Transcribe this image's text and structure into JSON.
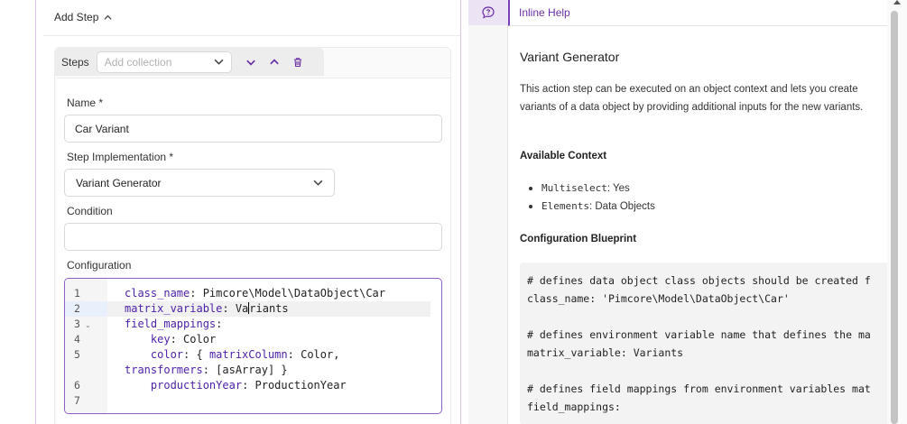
{
  "workflow": {
    "add_step_label": "Add Step",
    "steps_label": "Steps",
    "collection_placeholder": "Add collection"
  },
  "form": {
    "name_label": "Name",
    "name_value": "Car Variant",
    "step_impl_label": "Step Implementation",
    "step_impl_value": "Variant Generator",
    "condition_label": "Condition",
    "condition_value": "",
    "configuration_label": "Configuration",
    "required_mark": "*"
  },
  "editor": {
    "line_numbers": [
      "1",
      "2",
      "3",
      "4",
      "5",
      "6",
      "7"
    ],
    "lines": [
      {
        "key": "class_name",
        "rest": ": Pimcore\\Model\\DataObject\\Car"
      },
      {
        "key": "matrix_variable",
        "rest": ": Va",
        "rest2": "riants"
      },
      {
        "key": "field_mappings",
        "rest": ":"
      },
      {
        "indent": "    ",
        "key": "key",
        "rest": ": Color"
      },
      {
        "indent": "    ",
        "key": "color",
        "rest": ": { ",
        "key2": "matrixColumn",
        "rest2": ": Color,"
      },
      {
        "key": "transformers",
        "rest": ": [asArray] }"
      },
      {
        "indent": "    ",
        "key": "productionYear",
        "rest": ": ProductionYear"
      }
    ]
  },
  "help": {
    "header": "Inline Help",
    "title": "Variant Generator",
    "description": "This action step can be executed on an object context and lets you create variants of a data object by providing additional inputs for the new variants.",
    "available_context_title": "Available Context",
    "context_items": [
      {
        "key": "Multiselect",
        "value": ": Yes"
      },
      {
        "key": "Elements",
        "value": ": Data Objects"
      }
    ],
    "blueprint_title": "Configuration Blueprint",
    "blueprint_lines": [
      "# defines data object class objects should be created f",
      "class_name: 'Pimcore\\Model\\DataObject\\Car'",
      "",
      "# defines environment variable name that defines the ma",
      "matrix_variable: Variants",
      "",
      "# defines field mappings from environment variables mat",
      "field_mappings:"
    ]
  },
  "colors": {
    "accent": "#7a3fb6",
    "editor_border": "#8e5fc3"
  }
}
